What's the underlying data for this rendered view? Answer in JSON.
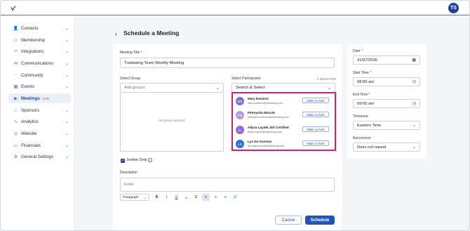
{
  "header": {
    "user_initials": "TS"
  },
  "sidebar": {
    "items": [
      {
        "label": "Contacts",
        "icon": "users-icon"
      },
      {
        "label": "Membership",
        "icon": "people-icon"
      },
      {
        "label": "Integrations",
        "icon": "link-icon"
      },
      {
        "label": "Communications",
        "icon": "mail-icon"
      },
      {
        "label": "Community",
        "icon": "chat-icon"
      },
      {
        "label": "Events",
        "icon": "calendar-icon"
      },
      {
        "label": "Meetings",
        "icon": "video-icon",
        "badge": "LIVE",
        "active": true
      },
      {
        "label": "Sponsors",
        "icon": "handshake-icon"
      },
      {
        "label": "Analytics",
        "icon": "chart-icon"
      },
      {
        "label": "Website",
        "icon": "globe-icon"
      },
      {
        "label": "Financials",
        "icon": "wallet-icon"
      },
      {
        "label": "General Settings",
        "icon": "gear-icon"
      }
    ]
  },
  "page": {
    "title": "Schedule a Meeting"
  },
  "form": {
    "meeting_title_label": "Meeting Title",
    "meeting_title_value": "Tradewing Team Weekly Meeting",
    "select_group_label": "Select Group",
    "groups_placeholder": "Add groups",
    "no_group_text": "No group selected",
    "select_participants_label": "Select Participants",
    "selected_count": "4 SELECTED",
    "participants_placeholder": "Search & Select",
    "participants": [
      {
        "initials": "MR",
        "name": "Mary Ramirez",
        "email": "mary.ramirez@tradewing.com",
        "color": "#7b6fd6",
        "cohost_label": "Make co-host"
      },
      {
        "initials": "PM",
        "name": "Petreysha Macute",
        "email": "petreysha.macute@tradewing.com",
        "color": "#b59ad8",
        "cohost_label": "Make co-host"
      },
      {
        "initials": "AL",
        "name": "Allysa Laydel, MS Certified",
        "email": "allysa.laydel@tradewing.com",
        "color": "#8c6be0",
        "cohost_label": "Make co-host"
      },
      {
        "initials": "LD",
        "name": "Lyn De Guzman",
        "email": "lyn.deguzman@tradewing.com",
        "color": "#2f6fd6",
        "cohost_label": "Make co-host"
      }
    ],
    "invitee_only_label": "Invitee Only",
    "description_label": "Description",
    "description_placeholder": "Enter",
    "toolbar": {
      "paragraph_label": "Paragraph"
    },
    "cancel_label": "Cancel",
    "schedule_label": "Schedule"
  },
  "details": {
    "date_label": "Date",
    "date_value": "31/07/2026",
    "start_time_label": "Start Time",
    "start_time_value": "08:00 am",
    "end_time_label": "End Time",
    "end_time_value": "09:00 am",
    "timezone_label": "Timezone",
    "timezone_value": "Eastern Time",
    "recurrence_label": "Recurrence",
    "recurrence_value": "Does not repeat"
  },
  "colors": {
    "accent": "#1f57b8",
    "highlight_border": "#d61f6e"
  }
}
